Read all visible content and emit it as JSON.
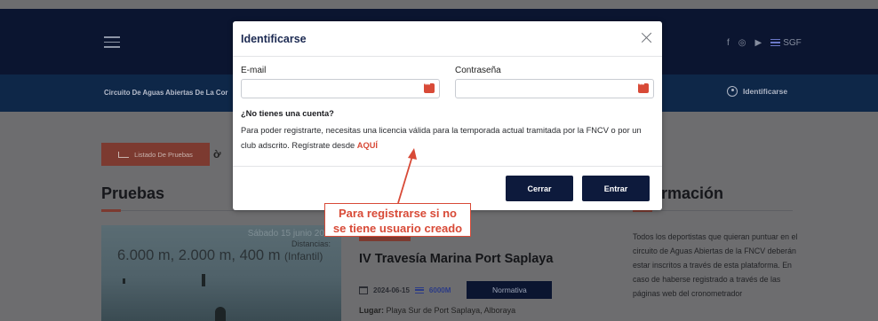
{
  "header": {
    "social_labels": [
      "f",
      "◎",
      "▶"
    ],
    "sgf_label": "SGF"
  },
  "subbar": {
    "breadcrumb": "Circuito De Aguas Abiertas De La Cor",
    "identify_label": "Identificarse"
  },
  "page": {
    "listado_button": "Listado De Pruebas",
    "pruebas_heading": "Pruebas",
    "info_heading": "rmación",
    "race": {
      "image_date": "Sábado 15 junio 2024",
      "image_distances_label": "Distancias:",
      "image_distances": "6.000 m, 2.000 m, 400 m",
      "image_distances_note": "(Infantil)",
      "title": "IV Travesía Marina Port Saplaya",
      "date": "2024-06-15",
      "distance": "6000M",
      "normativa_button": "Normativa",
      "place_label": "Lugar:",
      "place_value": "Playa Sur de Port Saplaya, Alboraya"
    },
    "info_text": "Todos los deportistas que quieran puntuar en el circuito de Aguas Abiertas de la FNCV deberán estar inscritos a través de esta plataforma. En caso de haberse registrado a través de las páginas web del cronometrador"
  },
  "modal": {
    "title": "Identificarse",
    "email_label": "E-mail",
    "email_value": "",
    "password_label": "Contraseña",
    "password_value": "",
    "no_account_heading": "¿No tienes una cuenta?",
    "register_text": "Para poder registrarte, necesitas una licencia válida para la temporada actual tramitada por la FNCV o por un club adscrito. Regístrate desde",
    "register_link": "AQUÍ",
    "close_button": "Cerrar",
    "enter_button": "Entrar"
  },
  "annotation": {
    "callout_text_line1": "Para registrarse si no",
    "callout_text_line2": "se tiene usuario creado",
    "color": "#d84a37"
  },
  "colors": {
    "navy": "#0d1a3c",
    "accent_red": "#d84a37"
  }
}
